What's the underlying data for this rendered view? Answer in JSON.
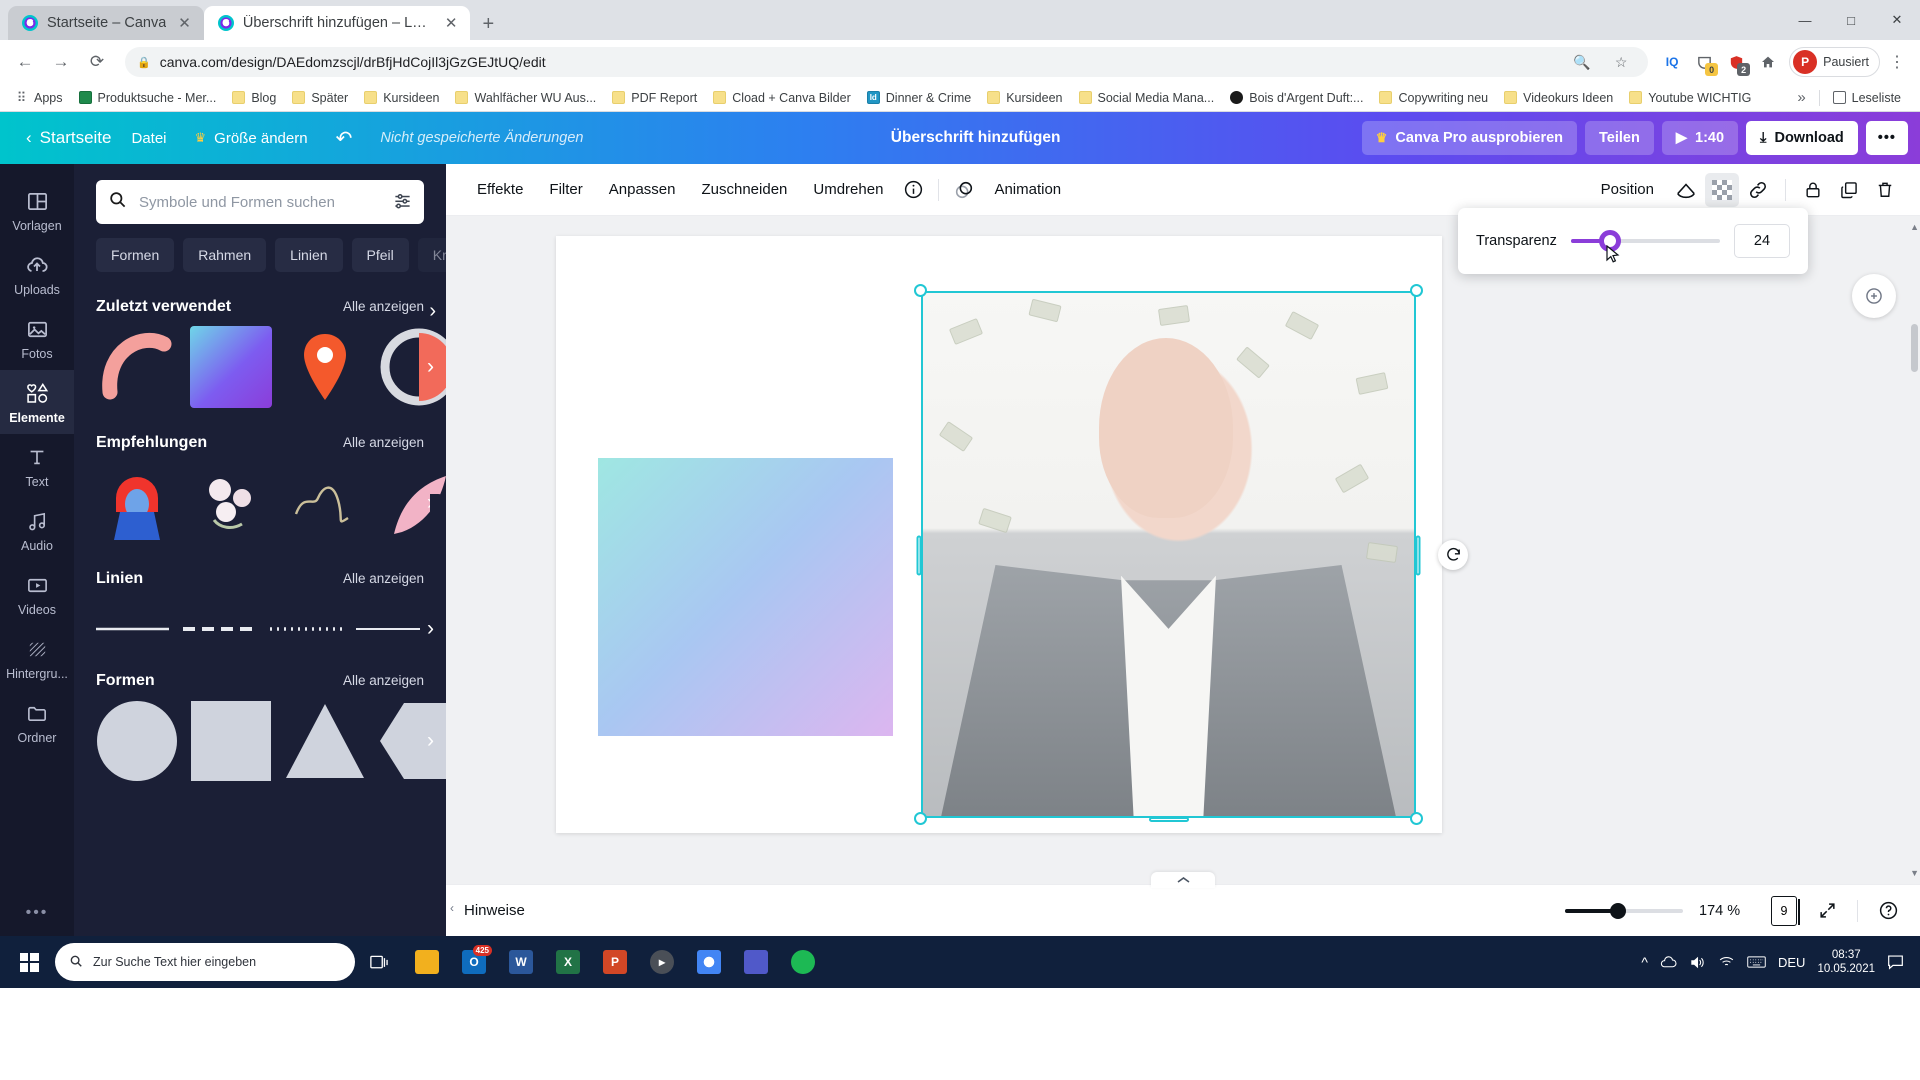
{
  "browser": {
    "tabs": [
      {
        "title": "Startseite – Canva",
        "active": false,
        "favicon": "canva-icon"
      },
      {
        "title": "Überschrift hinzufügen – Logo",
        "active": true,
        "favicon": "canva-icon"
      }
    ],
    "new_tab_label": "+",
    "window_controls": {
      "minimize": "—",
      "maximize": "□",
      "close": "✕"
    },
    "nav": {
      "back": "←",
      "forward": "→",
      "reload": "⟳"
    },
    "omnibox": {
      "lock_icon": "lock-icon",
      "url": "canva.com/design/DAEdomzscjl/drBfjHdCojIl3jGzGEJtUQ/edit",
      "zoom_icon": "search-zoom-icon",
      "star_icon": "bookmark-star-icon"
    },
    "extensions": [
      {
        "name": "IQ",
        "label": "IQ"
      },
      {
        "name": "pocket",
        "label": "",
        "badge": "0",
        "badge_color": "#f5c542"
      },
      {
        "name": "adblock",
        "label": "",
        "badge": "2",
        "badge_color": "#5f6368"
      },
      {
        "name": "home",
        "label": ""
      }
    ],
    "profile": {
      "initial": "P",
      "name": "Pausiert"
    },
    "menu_icon": "kebab-menu-icon",
    "bookmarks": [
      {
        "label": "Apps",
        "icon": "apps-grid-icon"
      },
      {
        "label": "Produktsuche - Mer...",
        "icon": "folder-icon-green"
      },
      {
        "label": "Blog",
        "icon": "folder-icon"
      },
      {
        "label": "Später",
        "icon": "folder-icon"
      },
      {
        "label": "Kursideen",
        "icon": "folder-icon"
      },
      {
        "label": "Wahlfächer WU Aus...",
        "icon": "folder-icon"
      },
      {
        "label": "PDF Report",
        "icon": "folder-icon"
      },
      {
        "label": "Cload + Canva Bilder",
        "icon": "folder-icon"
      },
      {
        "label": "Dinner & Crime",
        "icon": "indesign-icon"
      },
      {
        "label": "Kursideen",
        "icon": "folder-icon"
      },
      {
        "label": "Social Media Mana...",
        "icon": "folder-icon"
      },
      {
        "label": "Bois d'Argent Duft:...",
        "icon": "dark-circle-icon"
      },
      {
        "label": "Copywriting neu",
        "icon": "folder-icon"
      },
      {
        "label": "Videokurs Ideen",
        "icon": "folder-icon"
      },
      {
        "label": "Youtube WICHTIG",
        "icon": "folder-icon"
      }
    ],
    "bookmarks_overflow": "»",
    "reading_list": "Leseliste"
  },
  "canva_header": {
    "back_icon": "chevron-left-icon",
    "home": "Startseite",
    "file": "Datei",
    "resize": "Größe ändern",
    "resize_icon": "crown-icon",
    "undo_icon": "undo-arrow-icon",
    "unsaved": "Nicht gespeicherte Änderungen",
    "title": "Überschrift hinzufügen",
    "pro": "Canva Pro ausprobieren",
    "share": "Teilen",
    "present_time": "1:40",
    "present_icon": "play-icon",
    "download": "Download",
    "download_icon": "download-arrow-icon",
    "more": "•••"
  },
  "rail": {
    "items": [
      {
        "label": "Vorlagen",
        "icon": "templates-icon",
        "active": false
      },
      {
        "label": "Uploads",
        "icon": "cloud-upload-icon",
        "active": false
      },
      {
        "label": "Fotos",
        "icon": "photo-icon",
        "active": false
      },
      {
        "label": "Elemente",
        "icon": "shapes-icon",
        "active": true
      },
      {
        "label": "Text",
        "icon": "text-T-icon",
        "active": false
      },
      {
        "label": "Audio",
        "icon": "music-note-icon",
        "active": false
      },
      {
        "label": "Videos",
        "icon": "video-play-icon",
        "active": false
      },
      {
        "label": "Hintergru...",
        "icon": "background-hatch-icon",
        "active": false
      },
      {
        "label": "Ordner",
        "icon": "folder-icon",
        "active": false
      }
    ],
    "more_icon": "ellipsis-icon",
    "more_label": "•••"
  },
  "panel": {
    "search": {
      "placeholder": "Symbole und Formen suchen",
      "icon": "search-icon",
      "filter_icon": "sliders-icon"
    },
    "chips": [
      "Formen",
      "Rahmen",
      "Linien",
      "Pfeil",
      "Kreis"
    ],
    "chips_next_icon": "chevron-right-icon",
    "sections": [
      {
        "title": "Zuletzt verwendet",
        "see_all": "Alle anzeigen",
        "kind": "thumbs"
      },
      {
        "title": "Empfehlungen",
        "see_all": "Alle anzeigen",
        "kind": "thumbs"
      },
      {
        "title": "Linien",
        "see_all": "Alle anzeigen",
        "kind": "lines"
      },
      {
        "title": "Formen",
        "see_all": "Alle anzeigen",
        "kind": "shapes"
      }
    ],
    "collapse_icon": "chevron-left-icon"
  },
  "editor_toolbar": {
    "items": [
      "Effekte",
      "Filter",
      "Anpassen",
      "Zuschneiden",
      "Umdrehen"
    ],
    "info_icon": "info-circle-icon",
    "animation": "Animation",
    "animation_icon": "animation-circles-icon",
    "position": "Position",
    "right_icons": [
      {
        "name": "transparency-icon",
        "selected": false
      },
      {
        "name": "checker-transparency-icon",
        "selected": true
      },
      {
        "name": "link-icon",
        "selected": false
      },
      {
        "name": "lock-icon",
        "selected": false
      },
      {
        "name": "duplicate-icon",
        "selected": false
      },
      {
        "name": "trash-icon",
        "selected": false
      }
    ]
  },
  "transparency_popover": {
    "label": "Transparenz",
    "value": "24",
    "slider_percent": 24
  },
  "canvas": {
    "rotate_icon": "rotate-icon",
    "add_note_icon": "sparkle-add-icon"
  },
  "statusbar": {
    "notes": "Hinweise",
    "zoom": "174 %",
    "zoom_percent": 174,
    "page_number": "9",
    "pages_icon": "pages-icon",
    "fullscreen_icon": "expand-icon",
    "help_icon": "help-circle-icon",
    "collapse_icon": "chevron-up-icon"
  },
  "taskbar": {
    "start_icon": "windows-logo-icon",
    "search_placeholder": "Zur Suche Text hier eingeben",
    "search_icon": "search-icon",
    "taskview_icon": "task-view-icon",
    "apps": [
      {
        "name": "file-explorer",
        "label": "",
        "color": "#f2b01e"
      },
      {
        "name": "outlook",
        "label": "O",
        "color": "#0f6cbd",
        "badge": "425"
      },
      {
        "name": "word",
        "label": "W",
        "color": "#2b579a"
      },
      {
        "name": "excel",
        "label": "X",
        "color": "#217346"
      },
      {
        "name": "powerpoint",
        "label": "P",
        "color": "#d24726"
      },
      {
        "name": "media-player",
        "label": "",
        "color": "#4a4f57"
      },
      {
        "name": "chrome",
        "label": "",
        "color": "#4285f4"
      },
      {
        "name": "teams",
        "label": "",
        "color": "#5059c9"
      },
      {
        "name": "spotify",
        "label": "",
        "color": "#1db954"
      }
    ],
    "tray": {
      "chevron": "^",
      "onedrive_icon": "onedrive-icon",
      "volume_icon": "speaker-icon",
      "wifi_icon": "wifi-icon",
      "keyboard_icon": "keyboard-icon",
      "language": "DEU",
      "time": "08:37",
      "date": "10.05.2021",
      "notification_icon": "notification-icon"
    }
  },
  "colors": {
    "canva_teal": "#00c4cc",
    "canva_purple": "#8b3dd9",
    "selection": "#21c7d4",
    "panel_dark": "#1b1f36",
    "rail_dark": "#15182b"
  }
}
